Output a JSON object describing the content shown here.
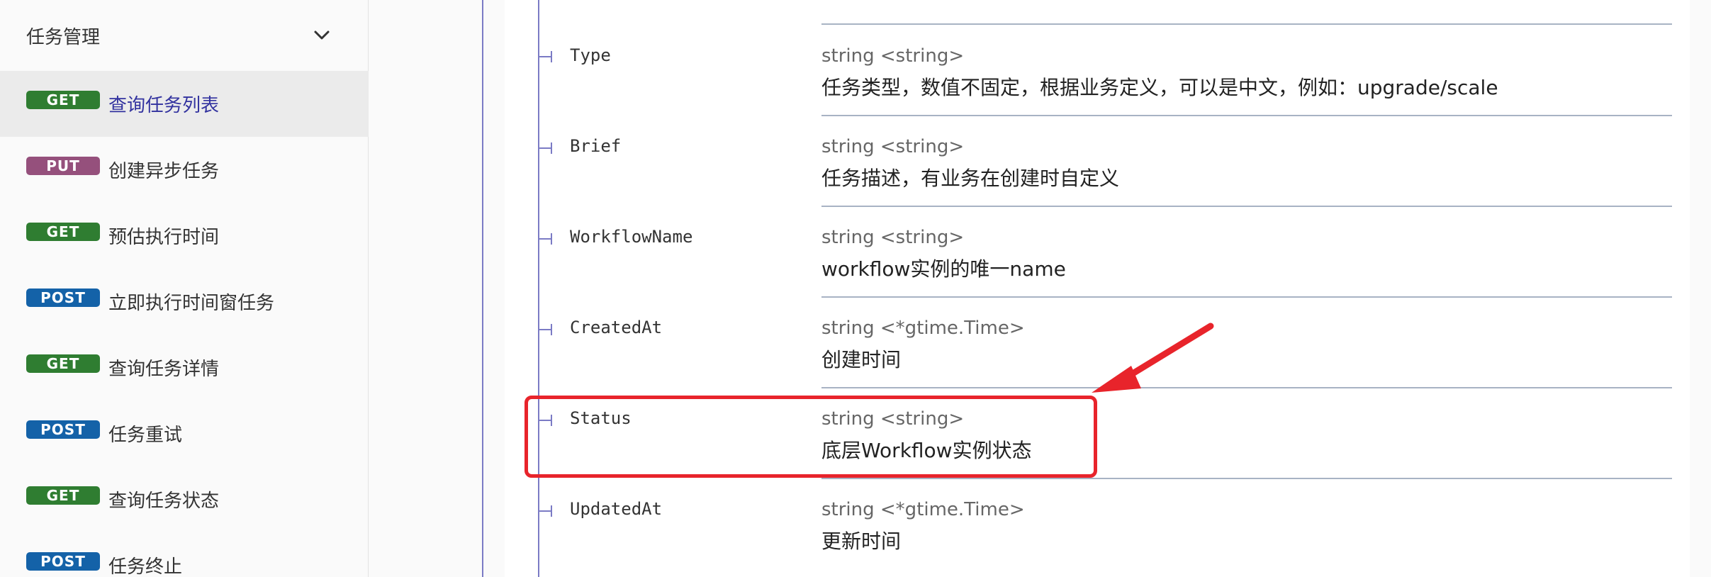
{
  "sidebar": {
    "group_title": "任务管理",
    "items": [
      {
        "method": "GET",
        "label": "查询任务列表",
        "active": true
      },
      {
        "method": "PUT",
        "label": "创建异步任务",
        "active": false
      },
      {
        "method": "GET",
        "label": "预估执行时间",
        "active": false
      },
      {
        "method": "POST",
        "label": "立即执行时间窗任务",
        "active": false
      },
      {
        "method": "GET",
        "label": "查询任务详情",
        "active": false
      },
      {
        "method": "POST",
        "label": "任务重试",
        "active": false
      },
      {
        "method": "GET",
        "label": "查询任务状态",
        "active": false
      },
      {
        "method": "POST",
        "label": "任务终止",
        "active": false
      }
    ]
  },
  "fields": [
    {
      "name": "Type",
      "type": "string <string>",
      "desc": "任务类型，数值不固定，根据业务定义，可以是中文，例如：upgrade/scale"
    },
    {
      "name": "Brief",
      "type": "string <string>",
      "desc": "任务描述，有业务在创建时自定义"
    },
    {
      "name": "WorkflowName",
      "type": "string <string>",
      "desc": "workflow实例的唯一name"
    },
    {
      "name": "CreatedAt",
      "type": "string <*gtime.Time>",
      "desc": "创建时间"
    },
    {
      "name": "Status",
      "type": "string <string>",
      "desc": "底层Workflow实例状态",
      "highlighted": true
    },
    {
      "name": "UpdatedAt",
      "type": "string <*gtime.Time>",
      "desc": "更新时间"
    }
  ],
  "colors": {
    "get": "#2f7d31",
    "put": "#95507c",
    "post": "#1462a8",
    "annotation": "#e8242b",
    "tree_line": "#7b7bc5"
  }
}
